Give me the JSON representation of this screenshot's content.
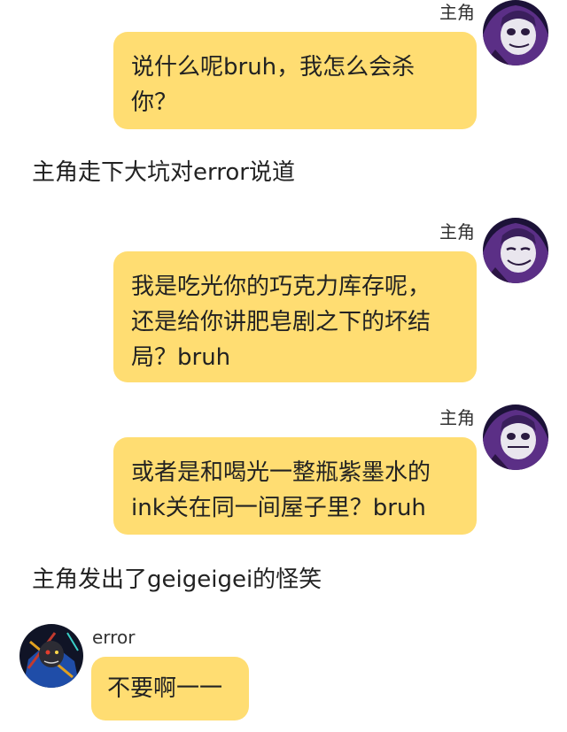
{
  "messages": [
    {
      "sender": "主角",
      "lines": [
        "说什么呢bruh，我怎么会杀",
        "你？"
      ],
      "avatar": "protagonist-skeleton-avatar"
    },
    {
      "narration": "主角走下大坑对error说道"
    },
    {
      "sender": "主角",
      "lines": [
        "我是吃光你的巧克力库存呢，",
        "还是给你讲肥皂剧之下的坏结",
        "局？bruh"
      ],
      "avatar": "protagonist-skeleton-avatar"
    },
    {
      "sender": "主角",
      "lines": [
        "或者是和喝光一整瓶紫墨水的",
        "ink关在同一间屋子里？bruh"
      ],
      "avatar": "protagonist-skeleton-avatar"
    },
    {
      "narration": "主角发出了geigeigei的怪笑"
    },
    {
      "sender": "error",
      "lines": [
        "不要啊一一"
      ],
      "avatar": "error-skeleton-avatar"
    }
  ],
  "colors": {
    "bubble": "#ffdd72",
    "background": "#ffffff",
    "text": "#222222"
  }
}
